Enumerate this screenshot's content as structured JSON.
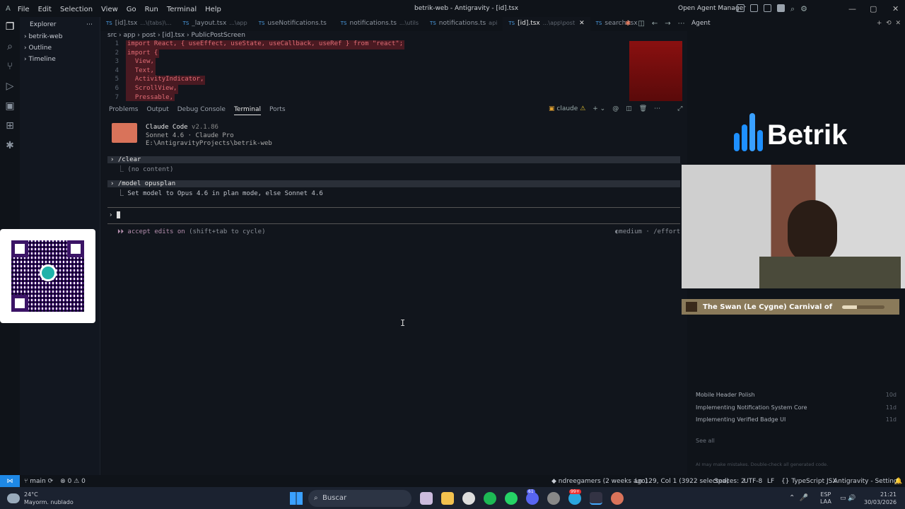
{
  "window": {
    "title": "betrik-web - Antigravity - [id].tsx",
    "open_agent_manager": "Open Agent Manager"
  },
  "menu": [
    "File",
    "Edit",
    "Selection",
    "View",
    "Go",
    "Run",
    "Terminal",
    "Help"
  ],
  "sidebar": {
    "title": "Explorer",
    "items": [
      "betrik-web",
      "Outline",
      "Timeline"
    ]
  },
  "tabs": [
    {
      "label": "[id].tsx",
      "hint": "...\\(tabs)\\...",
      "active": false
    },
    {
      "label": "_layout.tsx",
      "hint": "...\\app",
      "active": false
    },
    {
      "label": "useNotifications.ts",
      "hint": "",
      "active": false
    },
    {
      "label": "notifications.ts",
      "hint": "...\\utils",
      "active": false
    },
    {
      "label": "notifications.ts",
      "hint": "api",
      "active": false
    },
    {
      "label": "[id].tsx",
      "hint": "...\\app\\post",
      "active": true
    },
    {
      "label": "search.tsx",
      "hint": "",
      "active": false
    }
  ],
  "breadcrumb": [
    "src",
    "app",
    "post",
    "[id].tsx",
    "PublicPostScreen"
  ],
  "code": [
    {
      "n": "1",
      "t": "import React, { useEffect, useState, useCallback, useRef } from \"react\";"
    },
    {
      "n": "2",
      "t": "import {"
    },
    {
      "n": "3",
      "t": "  View,"
    },
    {
      "n": "4",
      "t": "  Text,"
    },
    {
      "n": "5",
      "t": "  ActivityIndicator,"
    },
    {
      "n": "6",
      "t": "  ScrollView,"
    },
    {
      "n": "7",
      "t": "  Pressable,"
    }
  ],
  "panel": {
    "tabs": [
      "Problems",
      "Output",
      "Debug Console",
      "Terminal",
      "Ports"
    ],
    "active": "Terminal",
    "shell": "claude"
  },
  "terminal": {
    "app": "Claude Code",
    "version": "v2.1.86",
    "model": "Sonnet 4.6 · Claude Pro",
    "path": "E:\\AntigravityProjects\\betrik-web",
    "cmd1": "/clear",
    "out1": "(no content)",
    "cmd2": "/model opusplan",
    "out2": "Set model to Opus 4.6 in plan mode, else Sonnet 4.6",
    "hint": "accept edits on",
    "hint2": "(shift+tab to cycle)",
    "effort": "medium · /effort"
  },
  "agent": {
    "title": "Agent",
    "brand": "Betrik",
    "now_playing": "The Swan (Le Cygne) Carnival of",
    "progress": 0.35,
    "history": [
      {
        "t": "Mobile Header Polish",
        "d": "10d"
      },
      {
        "t": "Implementing Notification System Core",
        "d": "11d"
      },
      {
        "t": "Implementing Verified Badge UI",
        "d": "11d"
      }
    ],
    "see_all": "See all",
    "disclaimer": "AI may make mistakes. Double-check all generated code."
  },
  "status": {
    "branch": "main",
    "problems": "0",
    "warnings": "0",
    "blame": "ndreegamers (2 weeks ago)",
    "pos": "Ln 129, Col 1 (3922 selected)",
    "spaces": "Spaces: 2",
    "enc": "UTF-8",
    "eol": "LF",
    "lang": "TypeScript JSX",
    "settings": "Antigravity - Settings"
  },
  "taskbar": {
    "weather": "24°C",
    "weather_desc": "Mayorm. nublado",
    "search": "Buscar",
    "lang": "ESP",
    "lang2": "LAA",
    "time": "21:21",
    "date": "30/03/2026",
    "badge": "99+",
    "badge2": "61"
  },
  "colors": {
    "accent": "#1e88e5",
    "brand": "#1e90ff",
    "terminal_bg": "#11151c"
  }
}
